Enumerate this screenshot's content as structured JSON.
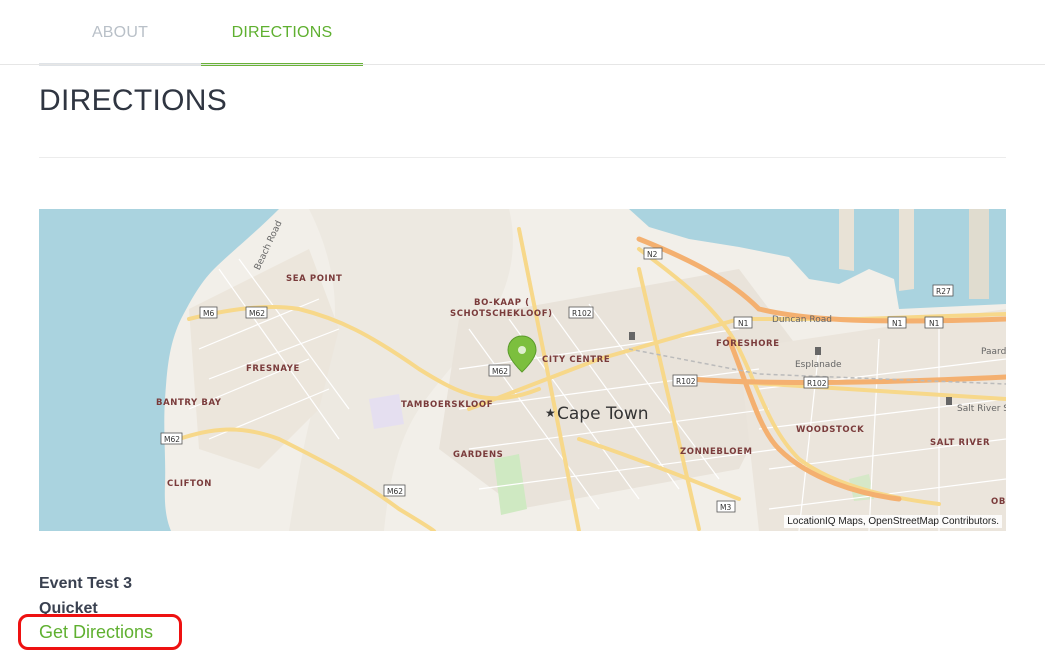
{
  "tabs": [
    {
      "label": "ABOUT",
      "active": false
    },
    {
      "label": "DIRECTIONS",
      "active": true
    }
  ],
  "page": {
    "title": "DIRECTIONS"
  },
  "map": {
    "attribution": "LocationIQ Maps, OpenStreetMap Contributors.",
    "city_label": "Cape Town",
    "area_labels": [
      "SEA POINT",
      "BO-KAAP (",
      "SCHOTSCHEKLOOF)",
      "CITY CENTRE",
      "FORESHORE",
      "FRESNAYE",
      "BANTRY BAY",
      "TAMBOERSKLOOF",
      "WOODSTOCK",
      "SALT RIVER",
      "GARDENS",
      "ZONNEBLOEM",
      "CLIFTON",
      "OB"
    ],
    "road_shields": [
      "N2",
      "R27",
      "M6",
      "M62",
      "R102",
      "N1",
      "N1",
      "N1",
      "M62",
      "R102",
      "R102",
      "M62",
      "M62",
      "M3"
    ],
    "other_labels": [
      "Beach Road",
      "Duncan Road",
      "Esplanade",
      "Salt River S",
      "Paard"
    ],
    "marker": "map-pin"
  },
  "event": {
    "name": "Event Test 3",
    "organizer": "Quicket"
  },
  "directions_link": "Get Directions",
  "colors": {
    "accent": "#6ab33a",
    "highlight": "#ee1111",
    "water": "#aad3df",
    "land": "#f2efe9"
  }
}
